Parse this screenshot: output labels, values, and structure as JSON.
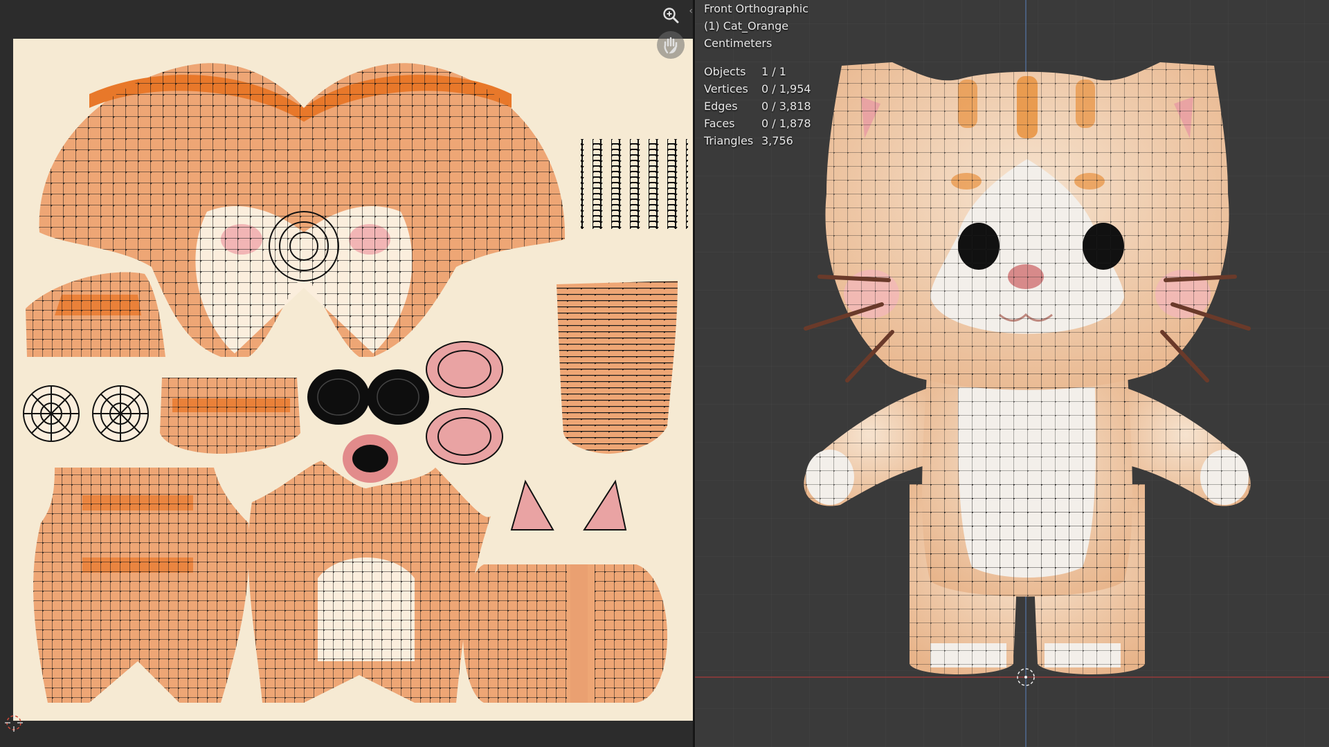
{
  "viewport": {
    "view_name": "Front Orthographic",
    "object_name": "(1) Cat_Orange",
    "units": "Centimeters",
    "stats": [
      {
        "label": "Objects",
        "value": "1 / 1"
      },
      {
        "label": "Vertices",
        "value": "0 / 1,954"
      },
      {
        "label": "Edges",
        "value": "0 / 3,818"
      },
      {
        "label": "Faces",
        "value": "0 / 1,878"
      },
      {
        "label": "Triangles",
        "value": "3,756"
      }
    ]
  },
  "uv_editor": {
    "tools": [
      "zoom-icon",
      "hand-pan-icon"
    ],
    "region_toggle": "‹›"
  },
  "colors": {
    "texture_bg": "#f6ead3",
    "orange_fur": "#eea675",
    "orange_stripe": "#e8782a",
    "cream": "#fbeedd",
    "pink": "#e9a3a3",
    "viewport_bg": "#3a3a3a",
    "mesh_wire": "#1a1a1a"
  }
}
